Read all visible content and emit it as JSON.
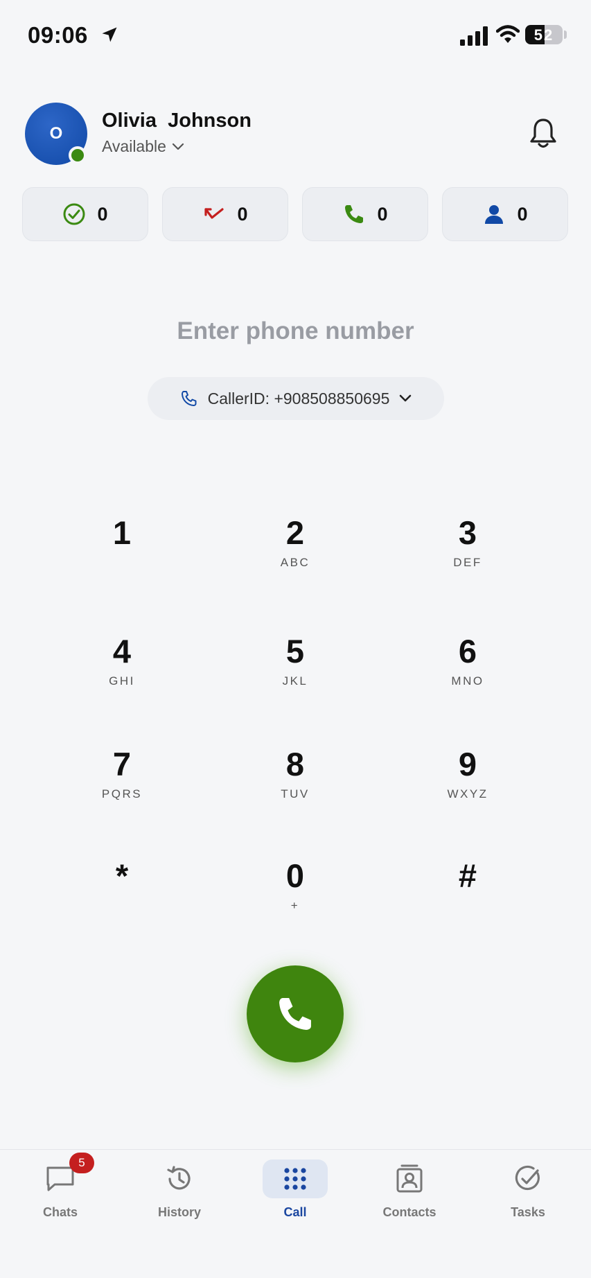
{
  "status_bar": {
    "time": "09:06",
    "battery": "52",
    "battery_level": 0.52
  },
  "profile": {
    "avatar_initial": "O",
    "name": "Olivia  Johnson",
    "status": "Available"
  },
  "stats": [
    {
      "icon": "check-circle-icon",
      "count": "0",
      "color": "#3b8a12"
    },
    {
      "icon": "missed-call-icon",
      "count": "0",
      "color": "#c41f1f"
    },
    {
      "icon": "phone-icon",
      "count": "0",
      "color": "#3b8a12"
    },
    {
      "icon": "person-icon",
      "count": "0",
      "color": "#1149a6"
    }
  ],
  "dialer": {
    "placeholder": "Enter phone number",
    "caller_id": "CallerID: +908508850695"
  },
  "keypad": [
    {
      "digit": "1",
      "letters": ""
    },
    {
      "digit": "2",
      "letters": "ABC"
    },
    {
      "digit": "3",
      "letters": "DEF"
    },
    {
      "digit": "4",
      "letters": "GHI"
    },
    {
      "digit": "5",
      "letters": "JKL"
    },
    {
      "digit": "6",
      "letters": "MNO"
    },
    {
      "digit": "7",
      "letters": "PQRS"
    },
    {
      "digit": "8",
      "letters": "TUV"
    },
    {
      "digit": "9",
      "letters": "WXYZ"
    },
    {
      "digit": "*",
      "letters": ""
    },
    {
      "digit": "0",
      "letters": "+"
    },
    {
      "digit": "#",
      "letters": ""
    }
  ],
  "colors": {
    "accent": "#1149a6",
    "call": "#3f850e",
    "badge": "#c41f1f"
  },
  "tabs": [
    {
      "label": "Chats",
      "icon": "chat-bubble-icon",
      "badge": "5"
    },
    {
      "label": "History",
      "icon": "history-icon"
    },
    {
      "label": "Call",
      "icon": "dialpad-icon",
      "active": true
    },
    {
      "label": "Contacts",
      "icon": "contacts-icon"
    },
    {
      "label": "Tasks",
      "icon": "tasks-icon"
    }
  ]
}
